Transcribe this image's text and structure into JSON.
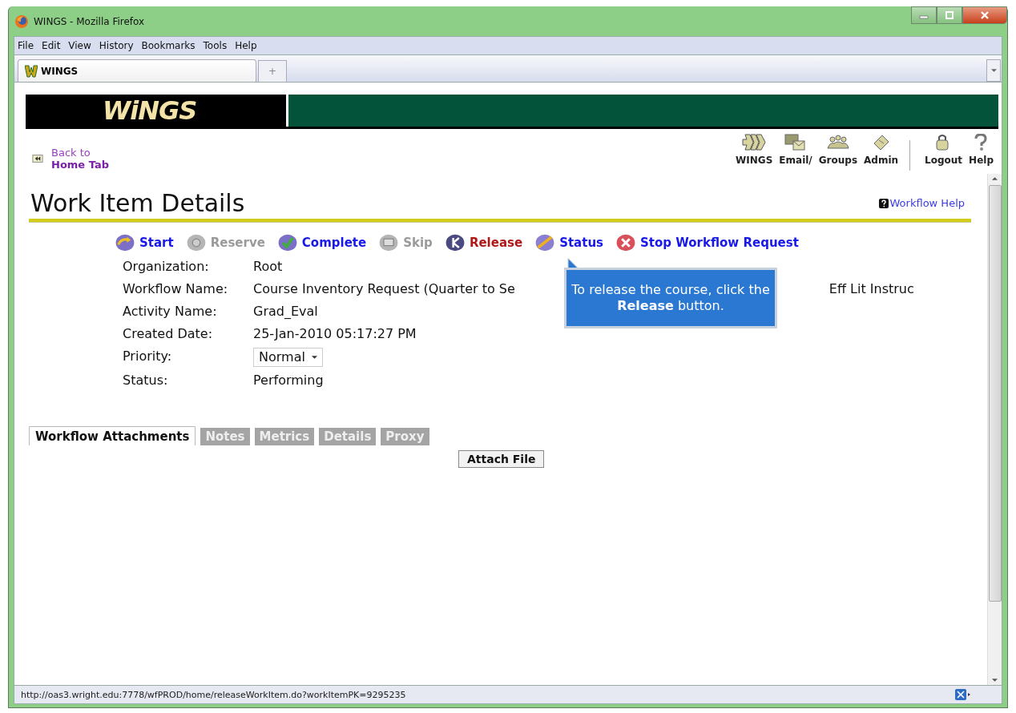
{
  "window": {
    "title": "WINGS - Mozilla Firefox"
  },
  "menu": [
    "File",
    "Edit",
    "View",
    "History",
    "Bookmarks",
    "Tools",
    "Help"
  ],
  "tabs": [
    {
      "label": "WINGS",
      "selected": true
    }
  ],
  "new_tab": "+",
  "banner": {
    "logo": "WiNGS"
  },
  "back_link": {
    "line1": "Back to",
    "line2": "Home Tab"
  },
  "nav": [
    {
      "label": "WINGS"
    },
    {
      "label": "Email/"
    },
    {
      "label": "Groups"
    },
    {
      "label": "Admin"
    },
    {
      "label": "Logout"
    },
    {
      "label": "Help"
    }
  ],
  "page_title": "Work Item Details",
  "help_link": "Workflow Help",
  "actions": [
    {
      "label": "Start",
      "disabled": false,
      "hovered": false
    },
    {
      "label": "Reserve",
      "disabled": true,
      "hovered": false
    },
    {
      "label": "Complete",
      "disabled": false,
      "hovered": false
    },
    {
      "label": "Skip",
      "disabled": true,
      "hovered": false
    },
    {
      "label": "Release",
      "disabled": false,
      "hovered": true
    },
    {
      "label": "Status",
      "disabled": false,
      "hovered": false
    },
    {
      "label": "Stop Workflow Request",
      "disabled": false,
      "hovered": false
    }
  ],
  "tooltip": "To release the course, click the **Release** button.",
  "fields": [
    {
      "label": "Organization:",
      "kind": "text",
      "value": "Root"
    },
    {
      "label": "Workflow Name:",
      "kind": "split",
      "value": "Course Inventory Request (Quarter to Se",
      "value_end": "Eff Lit Instruc"
    },
    {
      "label": "Activity Name:",
      "kind": "text",
      "value": "Grad_Eval"
    },
    {
      "label": "Created Date:",
      "kind": "text",
      "value": "25-Jan-2010 05:17:27 PM"
    },
    {
      "label": "Priority:",
      "kind": "select",
      "value": "Normal"
    },
    {
      "label": "Status:",
      "kind": "text",
      "value": "Performing"
    }
  ],
  "detail_tabs": [
    {
      "label": "Workflow Attachments",
      "selected": true
    },
    {
      "label": "Notes",
      "selected": false
    },
    {
      "label": "Metrics",
      "selected": false
    },
    {
      "label": "Details",
      "selected": false
    },
    {
      "label": "Proxy",
      "selected": false
    }
  ],
  "attach_button": "Attach File",
  "status_bar": "http://oas3.wright.edu:7778/wfPROD/home/releaseWorkItem.do?workItemPK=9295235"
}
